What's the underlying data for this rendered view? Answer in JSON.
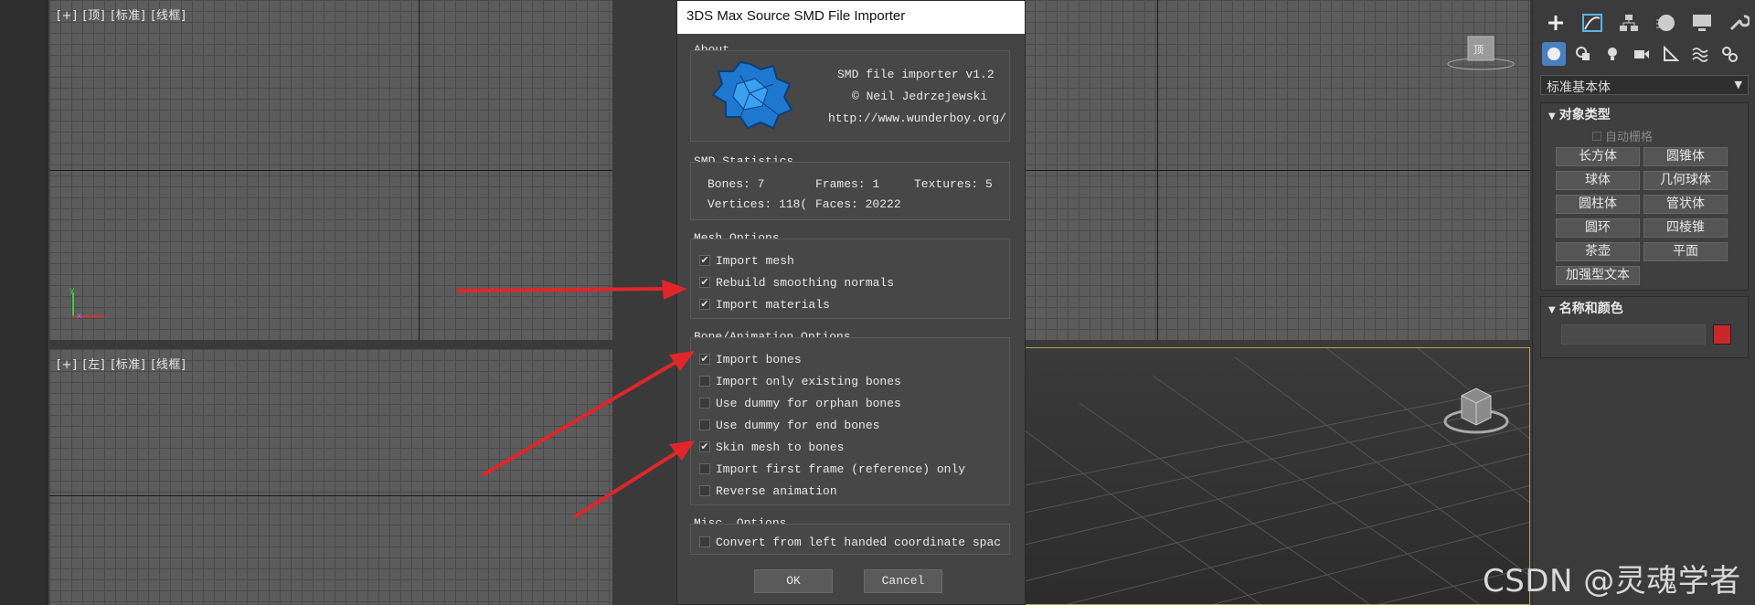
{
  "viewports": {
    "top_label": [
      "[+]",
      "[顶]",
      "[标准]",
      "[线框]"
    ],
    "left_label": [
      "[+]",
      "[左]",
      "[标准]",
      "[线框]"
    ]
  },
  "dialog": {
    "title": "3DS Max Source SMD File Importer",
    "about": {
      "title": "About",
      "line1": "SMD file importer v1.2",
      "line2": "© Neil Jedrzejewski",
      "line3": "http://www.wunderboy.org/"
    },
    "stats": {
      "title": "SMD Statistics",
      "bones": "Bones: 7",
      "frames": "Frames: 1",
      "textures": "Textures: 5",
      "vertices": "Vertices: 118(",
      "faces": "Faces: 20222"
    },
    "mesh": {
      "title": "Mesh Options",
      "options": [
        {
          "label": "Import mesh",
          "checked": true
        },
        {
          "label": "Rebuild smoothing normals",
          "checked": true
        },
        {
          "label": "Import materials",
          "checked": true
        }
      ]
    },
    "bone": {
      "title": "Bone/Animation Options",
      "options": [
        {
          "label": "Import bones",
          "checked": true
        },
        {
          "label": "Import only existing bones",
          "checked": false
        },
        {
          "label": "Use dummy for orphan bones",
          "checked": false
        },
        {
          "label": "Use dummy for end bones",
          "checked": false
        },
        {
          "label": "Skin mesh to bones",
          "checked": true
        },
        {
          "label": "Import first frame (reference) only",
          "checked": false
        },
        {
          "label": "Reverse animation",
          "checked": false
        }
      ]
    },
    "misc": {
      "title": "Misc. Options",
      "options": [
        {
          "label": "Convert from left handed coordinate spac",
          "checked": false
        }
      ]
    },
    "ok": "OK",
    "cancel": "Cancel"
  },
  "panel": {
    "dropdown": "标准基本体",
    "object_type": {
      "title": "对象类型",
      "autogrid": "自动栅格",
      "buttons": [
        "长方体",
        "圆锥体",
        "球体",
        "几何球体",
        "圆柱体",
        "管状体",
        "圆环",
        "四棱锥",
        "茶壶",
        "平面",
        "加强型文本"
      ]
    },
    "name_color": {
      "title": "名称和颜色",
      "color": "#c8282a"
    }
  },
  "watermark": "CSDN @灵魂学者",
  "colors": {
    "arrow": "#e0262a",
    "checkbox_check": "#dddddd"
  }
}
